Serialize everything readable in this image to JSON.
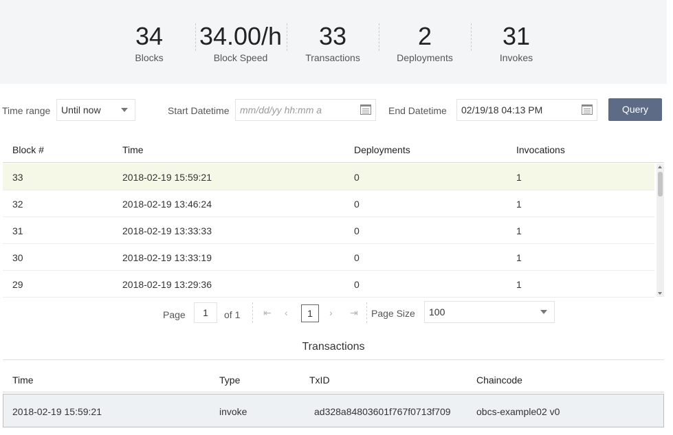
{
  "stats": [
    {
      "value": "34",
      "label": "Blocks"
    },
    {
      "value": "34.00/h",
      "label": "Block Speed"
    },
    {
      "value": "33",
      "label": "Transactions"
    },
    {
      "value": "2",
      "label": "Deployments"
    },
    {
      "value": "31",
      "label": "Invokes"
    }
  ],
  "filters": {
    "time_range_label": "Time range",
    "time_range_value": "Until now",
    "start_label": "Start Datetime",
    "start_placeholder": "mm/dd/yy hh:mm a",
    "end_label": "End Datetime",
    "end_value": "02/19/18 04:13 PM",
    "query_label": "Query"
  },
  "blocks_table": {
    "columns": [
      "Block #",
      "Time",
      "Deployments",
      "Invocations"
    ],
    "rows": [
      [
        "33",
        "2018-02-19 15:59:21",
        "0",
        "1"
      ],
      [
        "32",
        "2018-02-19 13:46:24",
        "0",
        "1"
      ],
      [
        "31",
        "2018-02-19 13:33:33",
        "0",
        "1"
      ],
      [
        "30",
        "2018-02-19 13:33:19",
        "0",
        "1"
      ],
      [
        "29",
        "2018-02-19 13:29:36",
        "0",
        "1"
      ]
    ],
    "selected_row": 0
  },
  "pagination": {
    "page_label": "Page",
    "page_value": "1",
    "of_label": "of 1",
    "current_page": "1",
    "page_size_label": "Page Size",
    "page_size_value": "100",
    "first_icon": "first-page-icon",
    "prev_icon": "prev-page-icon",
    "next_icon": "next-page-icon",
    "last_icon": "last-page-icon"
  },
  "transactions": {
    "title": "Transactions",
    "columns": [
      "Time",
      "Type",
      "TxID",
      "Chaincode"
    ],
    "rows": [
      [
        "2018-02-19 15:59:21",
        "invoke",
        "ad328a84803601f767f0713f709",
        "obcs-example02 v0"
      ]
    ]
  },
  "colors": {
    "accent_button": "#5e6b86",
    "selected_row": "#f5f8e6",
    "stats_background": "#f4f5f6"
  }
}
